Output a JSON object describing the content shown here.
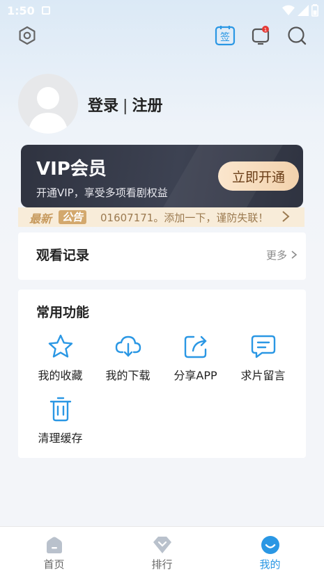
{
  "status_bar": {
    "time": "1:50"
  },
  "profile": {
    "login": "登录",
    "separator": "|",
    "register": "注册"
  },
  "vip": {
    "title": "VIP会员",
    "subtitle": "开通VIP，享受多项看剧权益",
    "button": "立即开通"
  },
  "notice": {
    "tag_new": "最新",
    "tag_notice": "公告",
    "text": "01607171。添加一下，谨防失联！"
  },
  "history": {
    "title": "观看记录",
    "more": "更多"
  },
  "functions": {
    "title": "常用功能",
    "items": [
      {
        "label": "我的收藏",
        "icon": "star-icon"
      },
      {
        "label": "我的下载",
        "icon": "cloud-download-icon"
      },
      {
        "label": "分享APP",
        "icon": "share-icon"
      },
      {
        "label": "求片留言",
        "icon": "message-icon"
      },
      {
        "label": "清理缓存",
        "icon": "trash-icon"
      }
    ]
  },
  "bottom_nav": {
    "items": [
      {
        "label": "首页",
        "icon": "home-icon"
      },
      {
        "label": "排行",
        "icon": "ranking-icon"
      },
      {
        "label": "我的",
        "icon": "profile-smile-icon"
      }
    ],
    "active_index": 2
  },
  "colors": {
    "accent": "#2a97e4",
    "vip_bg": "#353a48",
    "vip_button": "#f5d9b8",
    "notice_bg": "#f8ecd9",
    "badge": "#e53935"
  }
}
